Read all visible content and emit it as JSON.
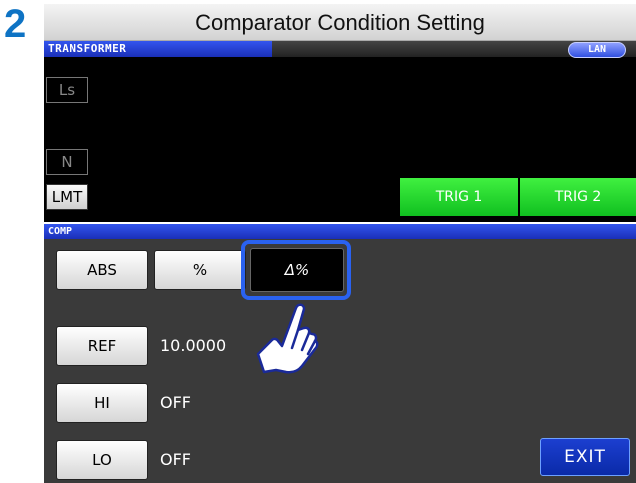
{
  "step": {
    "number": "2"
  },
  "title": "Comparator Condition Setting",
  "status_bar": {
    "mode": "TRANSFORMER",
    "lan_badge": "LAN"
  },
  "side_buttons": {
    "ls": "Ls",
    "n": "N",
    "lmt": "LMT"
  },
  "triggers": {
    "trig1": "TRIG 1",
    "trig2": "TRIG 2"
  },
  "comp": {
    "section_label": "COMP",
    "mode_buttons": {
      "abs": "ABS",
      "percent": "%",
      "delta_percent": "Δ%"
    },
    "selected_mode": "Δ%",
    "ref": {
      "label": "REF",
      "value": "10.0000"
    },
    "hi": {
      "label": "HI",
      "value": "OFF"
    },
    "lo": {
      "label": "LO",
      "value": "OFF"
    },
    "exit": "EXIT"
  },
  "icons": {
    "pointer": "pointing-hand-icon"
  },
  "colors": {
    "step_number": "#0e73c4",
    "header_tab": "#1a2fb8",
    "trigger_green": "#20d030",
    "exit_blue": "#0a2aa8",
    "highlight": "#2a62f0"
  }
}
